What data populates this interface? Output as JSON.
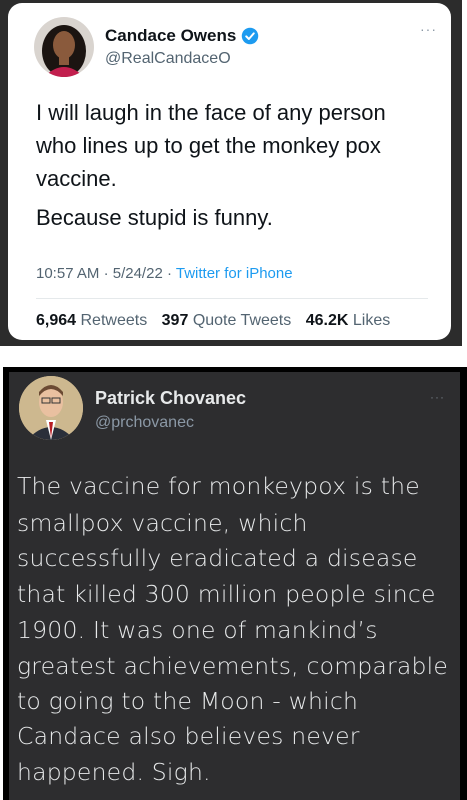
{
  "tweet1": {
    "name": "Candace Owens",
    "handle": "@RealCandaceO",
    "verified": true,
    "more_icon": "more-dots-icon",
    "text_lines": [
      "I will laugh in the face of any person",
      "who lines up to get the monkey pox",
      "vaccine.",
      "Because stupid is funny."
    ],
    "time": "10:57 AM",
    "date": "5/24/22",
    "source": "Twitter for iPhone",
    "retweets_count": "6,964",
    "retweets_label": "Retweets",
    "quote_count": "397",
    "quote_label": "Quote Tweets",
    "likes_count": "46.2K",
    "likes_label": "Likes",
    "accent_color": "#1d9bf0"
  },
  "tweet2": {
    "name": "Patrick Chovanec",
    "handle": "@prchovanec",
    "more_icon": "more-dots-icon",
    "text_lines": [
      "The vaccine for monkeypox is the",
      "smallpox vaccine, which",
      "successfully eradicated a disease",
      "that killed 300 million people since",
      "1900. It was one of mankind’s",
      "greatest achievements, comparable",
      "to going to the Moon - which",
      "Candace also believes never",
      "happened. Sigh."
    ]
  }
}
